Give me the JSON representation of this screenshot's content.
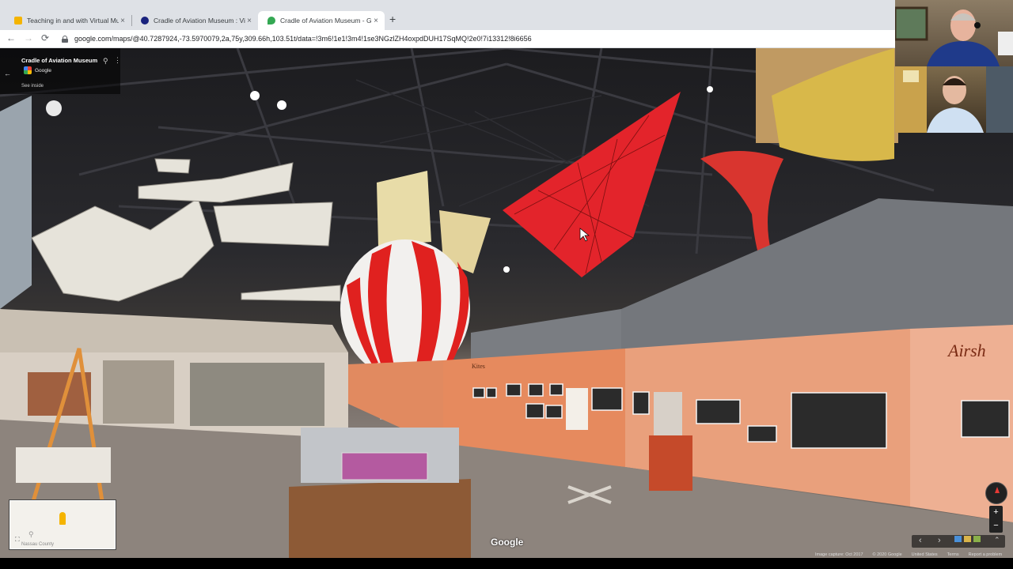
{
  "browser": {
    "tabs": [
      {
        "title": "Teaching in and with Virtual Mus",
        "color": "#f4b400",
        "active": false
      },
      {
        "title": "Cradle of Aviation Museum : Visi",
        "color": "#1a237e",
        "active": false
      },
      {
        "title": "Cradle of Aviation Museum - Go",
        "color": "#34a853",
        "active": true
      }
    ],
    "new_tab_label": "+",
    "close_label": "×",
    "url": "google.com/maps/@40.7287924,-73.5970079,2a,75y,309.66h,103.51t/data=!3m6!1e1!3m4!1se3NGzlZH4oxpdDUH17SqMQ!2e0!7i13312!8i6656",
    "back_icon": "←",
    "forward_icon": "→",
    "reload_icon": "⟳"
  },
  "maps": {
    "place_name": "Cradle of Aviation Museum",
    "source": "Google",
    "see_inside": "See inside",
    "back_icon": "←",
    "pin_icon": "⚲",
    "menu_icon": "⋮",
    "minimap_label": "Nassau County",
    "expand_icon": "⛶",
    "watermark": "Google",
    "zoom_in": "+",
    "zoom_out": "−",
    "prev_icon": "‹",
    "next_icon": "›",
    "collapse_icon": "⌃",
    "footer": {
      "image_capture": "Image capture: Oct 2017",
      "copyright": "© 2020 Google",
      "country": "United States",
      "terms": "Terms",
      "report": "Report a problem"
    }
  },
  "scene": {
    "wall_heading": "Airsh",
    "kites_caption": "Kites"
  }
}
